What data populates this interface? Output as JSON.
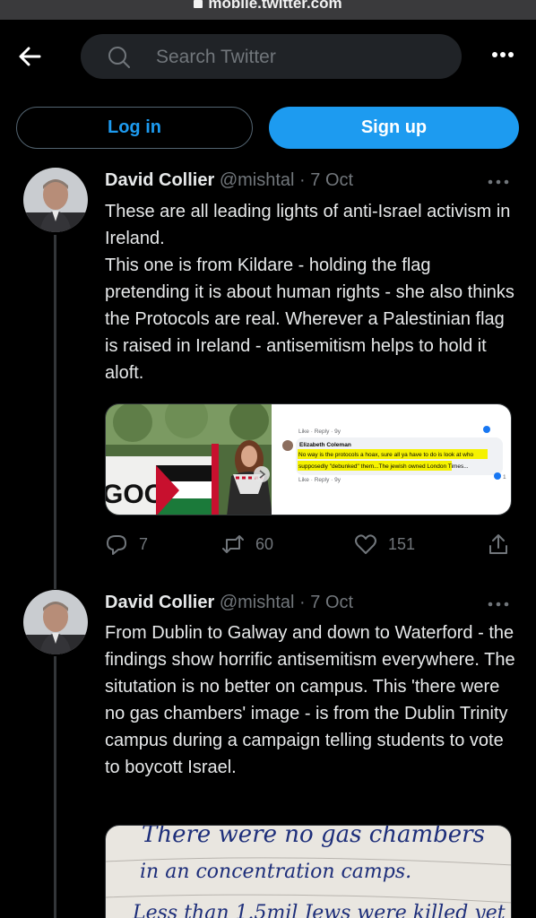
{
  "browser": {
    "url": "mobile.twitter.com"
  },
  "header": {
    "search_placeholder": "Search Twitter"
  },
  "auth": {
    "login_label": "Log in",
    "signup_label": "Sign up"
  },
  "colors": {
    "accent": "#1d9bf0",
    "background": "#000000",
    "muted": "#71767b"
  },
  "tweets": [
    {
      "name": "David Collier",
      "handle": "@mishtal",
      "separator": "·",
      "date": "7 Oct",
      "paragraphs": [
        "These are all leading lights of anti-Israel activism in Ireland.",
        "This one is from Kildare - holding the flag pretending it is about human rights - she also thinks the Protocols are real. Wherever a Palestinian flag is raised in Ireland - antisemitism helps to hold it aloft."
      ],
      "media": {
        "banner_text": "GOODS",
        "comment": {
          "top_meta": "Like · Reply · 9y",
          "author": "Elizabeth Coleman",
          "text": "No way is the protocols a hoax, sure all ya have to do is look at who supposedly \"debunked\" them...The jewish owned London Times...",
          "bottom_meta": "Like · Reply · 9y",
          "reactions": "1"
        }
      },
      "counts": {
        "replies": "7",
        "retweets": "60",
        "likes": "151"
      }
    },
    {
      "name": "David Collier",
      "handle": "@mishtal",
      "separator": "·",
      "date": "7 Oct",
      "paragraphs": [
        "From Dublin to Galway and down to Waterford - the findings show horrific antisemitism everywhere. The situtation is no better on campus. This 'there were no gas chambers' image - is from the Dublin Trinity campus during a campaign telling students to vote to boycott Israel."
      ],
      "media": {
        "handwriting": [
          "There were no gas chambers",
          "in an concentration camps.",
          "Less than 1.5mil Jews were killed yet"
        ]
      }
    }
  ]
}
